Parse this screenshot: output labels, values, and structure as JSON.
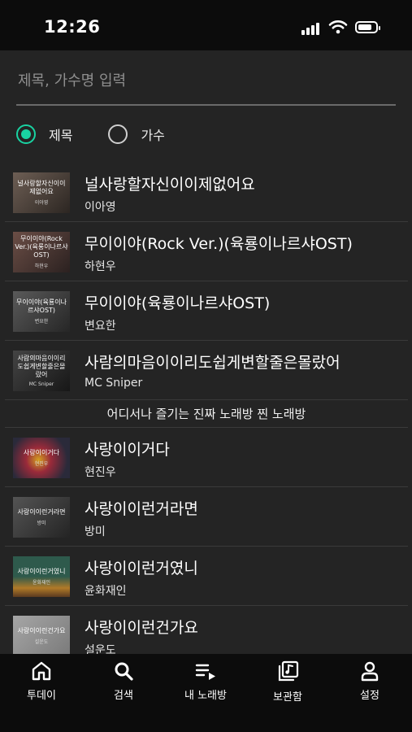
{
  "status": {
    "time": "12:26",
    "battery_level": 0.8
  },
  "search": {
    "placeholder": "제목, 가수명 입력",
    "value": ""
  },
  "filter": {
    "options": [
      {
        "label": "제목",
        "selected": true
      },
      {
        "label": "가수",
        "selected": false
      }
    ],
    "accent_color": "#19d3a2"
  },
  "results": [
    {
      "title": "널사랑할자신이이제없어요",
      "artist": "이아영",
      "thumb_title": "널사랑할자신이이제없어요",
      "thumb_artist": "이아영"
    },
    {
      "title": "무이이야(Rock Ver.)(육룡이나르샤OST)",
      "artist": "하현우",
      "thumb_title": "무이이야(Rock Ver.)(육룡이나르샤OST)",
      "thumb_artist": "하현우"
    },
    {
      "title": "무이이야(육룡이나르샤OST)",
      "artist": "변요한",
      "thumb_title": "무이이야(육룡이나르샤OST)",
      "thumb_artist": "변요한"
    },
    {
      "title": "사람의마음이이리도쉽게변할줄은몰랐어",
      "artist": "MC Sniper",
      "thumb_title": "사람의마음이이리도쉽게변할줄은몰랐어",
      "thumb_artist": "MC Sniper"
    }
  ],
  "banner": {
    "text": "어디서나 즐기는 진짜 노래방 찐 노래방"
  },
  "results2": [
    {
      "title": "사랑이이거다",
      "artist": "현진우",
      "thumb_title": "사랑이이거다",
      "thumb_artist": "현진우"
    },
    {
      "title": "사랑이이런거라면",
      "artist": "방미",
      "thumb_title": "사랑이이런거라면",
      "thumb_artist": "방미"
    },
    {
      "title": "사랑이이런거였니",
      "artist": "윤화재인",
      "thumb_title": "사랑이이런거였니",
      "thumb_artist": "윤화재인"
    },
    {
      "title": "사랑이이런건가요",
      "artist": "설운도",
      "thumb_title": "사랑이이런건가요",
      "thumb_artist": "설운도"
    }
  ],
  "tabs": [
    {
      "label": "투데이",
      "icon": "home-icon"
    },
    {
      "label": "검색",
      "icon": "search-icon"
    },
    {
      "label": "내 노래방",
      "icon": "playlist-icon"
    },
    {
      "label": "보관함",
      "icon": "library-icon"
    },
    {
      "label": "설정",
      "icon": "person-icon"
    }
  ]
}
